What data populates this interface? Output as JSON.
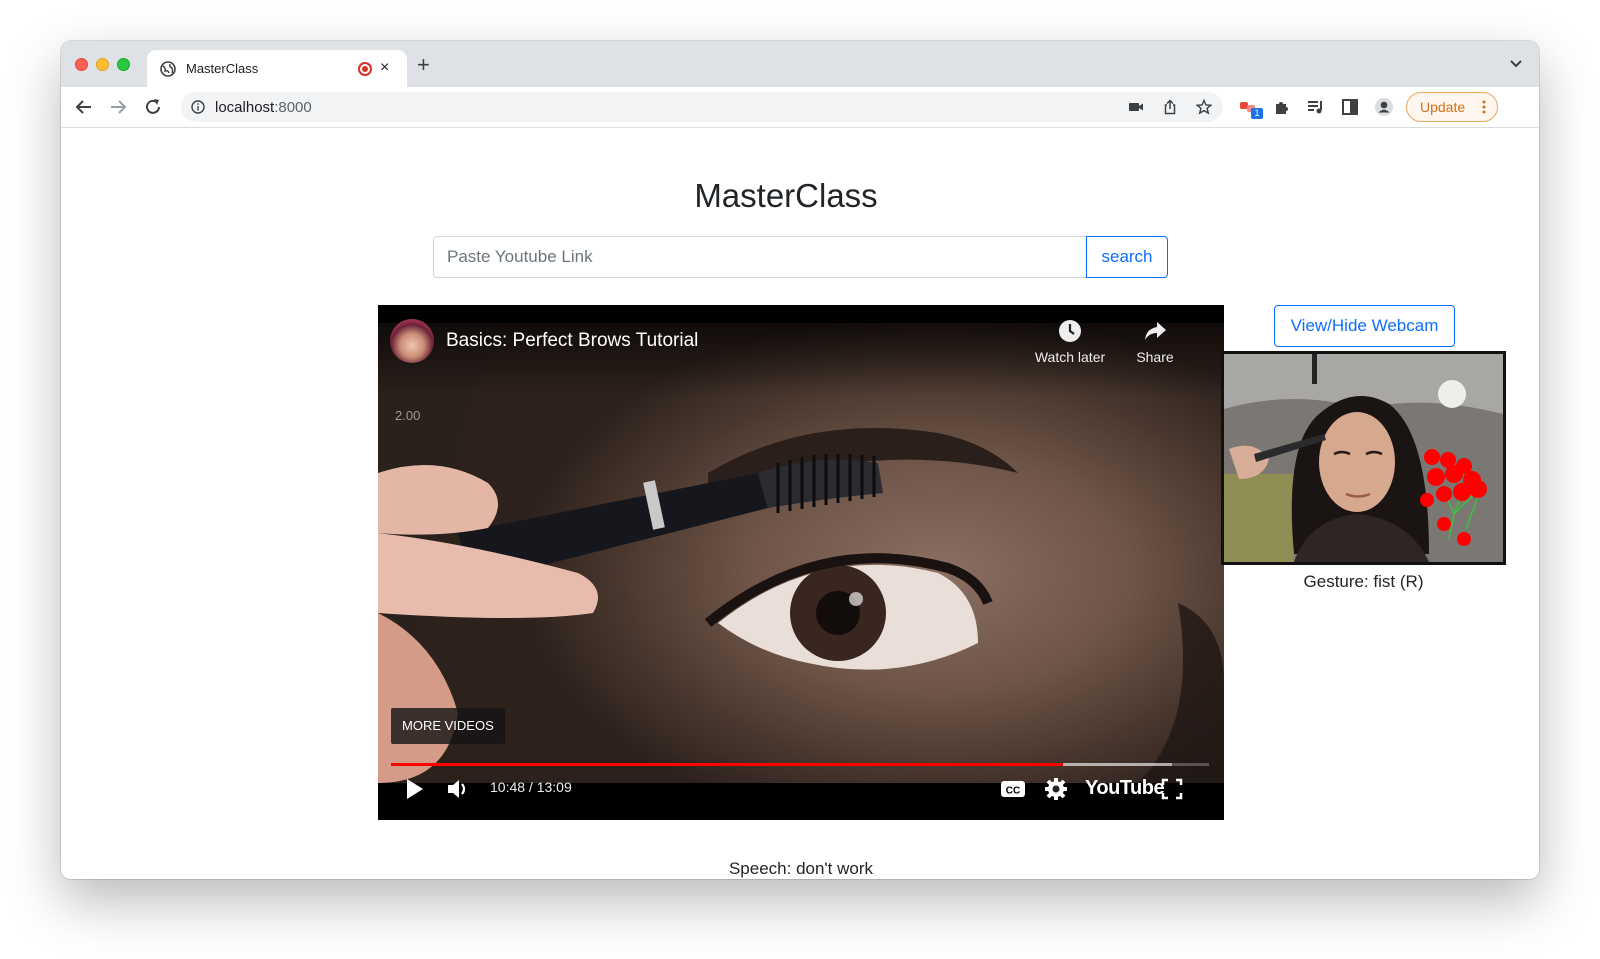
{
  "browser": {
    "tab_title": "MasterClass",
    "new_tab_symbol": "+",
    "close_symbol": "×",
    "url_host": "localhost",
    "url_port": ":8000",
    "extension_badge": "1",
    "update_label": "Update"
  },
  "page": {
    "title": "MasterClass",
    "search_placeholder": "Paste Youtube Link",
    "search_button": "search",
    "webcam_button": "View/Hide Webcam",
    "gesture_text": "Gesture: fist (R)",
    "speech_text": "Speech: don't work"
  },
  "player": {
    "video_title": "Basics: Perfect Brows Tutorial",
    "watch_later_label": "Watch later",
    "share_label": "Share",
    "speed_label": "2.00",
    "more_videos_label": "MORE VIDEOS",
    "time_display": "10:48 / 13:09",
    "logo_text": "YouTube",
    "progress_fraction": 0.822,
    "buffer_fraction": 0.955
  },
  "colors": {
    "accent": "#0d6efd",
    "progress": "#ff0000",
    "update": "#d56f17",
    "landmark": "#ff0000"
  }
}
